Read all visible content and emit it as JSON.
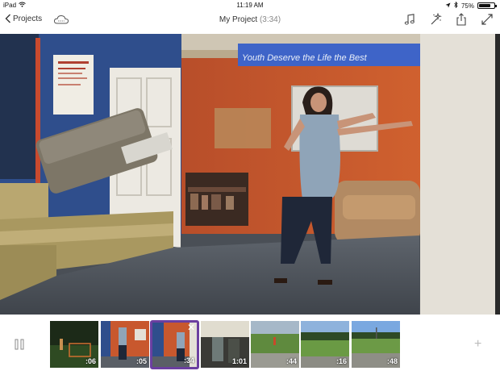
{
  "status_bar": {
    "device": "iPad",
    "time": "11:19 AM",
    "battery": "75%",
    "battery_level": 0.75
  },
  "nav": {
    "back_label": "Projects",
    "title": "My Project",
    "duration": "(3:34)"
  },
  "icons": {
    "back": "chevron-left-icon",
    "cloud": "cloud-icon",
    "music": "music-note-icon",
    "magic": "magic-wand-icon",
    "share": "share-icon",
    "fullscreen": "expand-icon",
    "pause": "pause-icon",
    "add": "plus-icon",
    "delete": "close-icon"
  },
  "timeline": {
    "add_label": "+",
    "clips": [
      {
        "duration": ":06",
        "selected": false
      },
      {
        "duration": ":05",
        "selected": false
      },
      {
        "duration": ":34",
        "selected": true,
        "delete_label": "✕"
      },
      {
        "duration": "1:01",
        "selected": false
      },
      {
        "duration": ":44",
        "selected": false
      },
      {
        "duration": ":16",
        "selected": false
      },
      {
        "duration": ":48",
        "selected": false
      }
    ]
  },
  "colors": {
    "selected_outline": "#6b3fa0",
    "wall_orange": "#c8582e",
    "wall_blue": "#2f4e8c"
  }
}
